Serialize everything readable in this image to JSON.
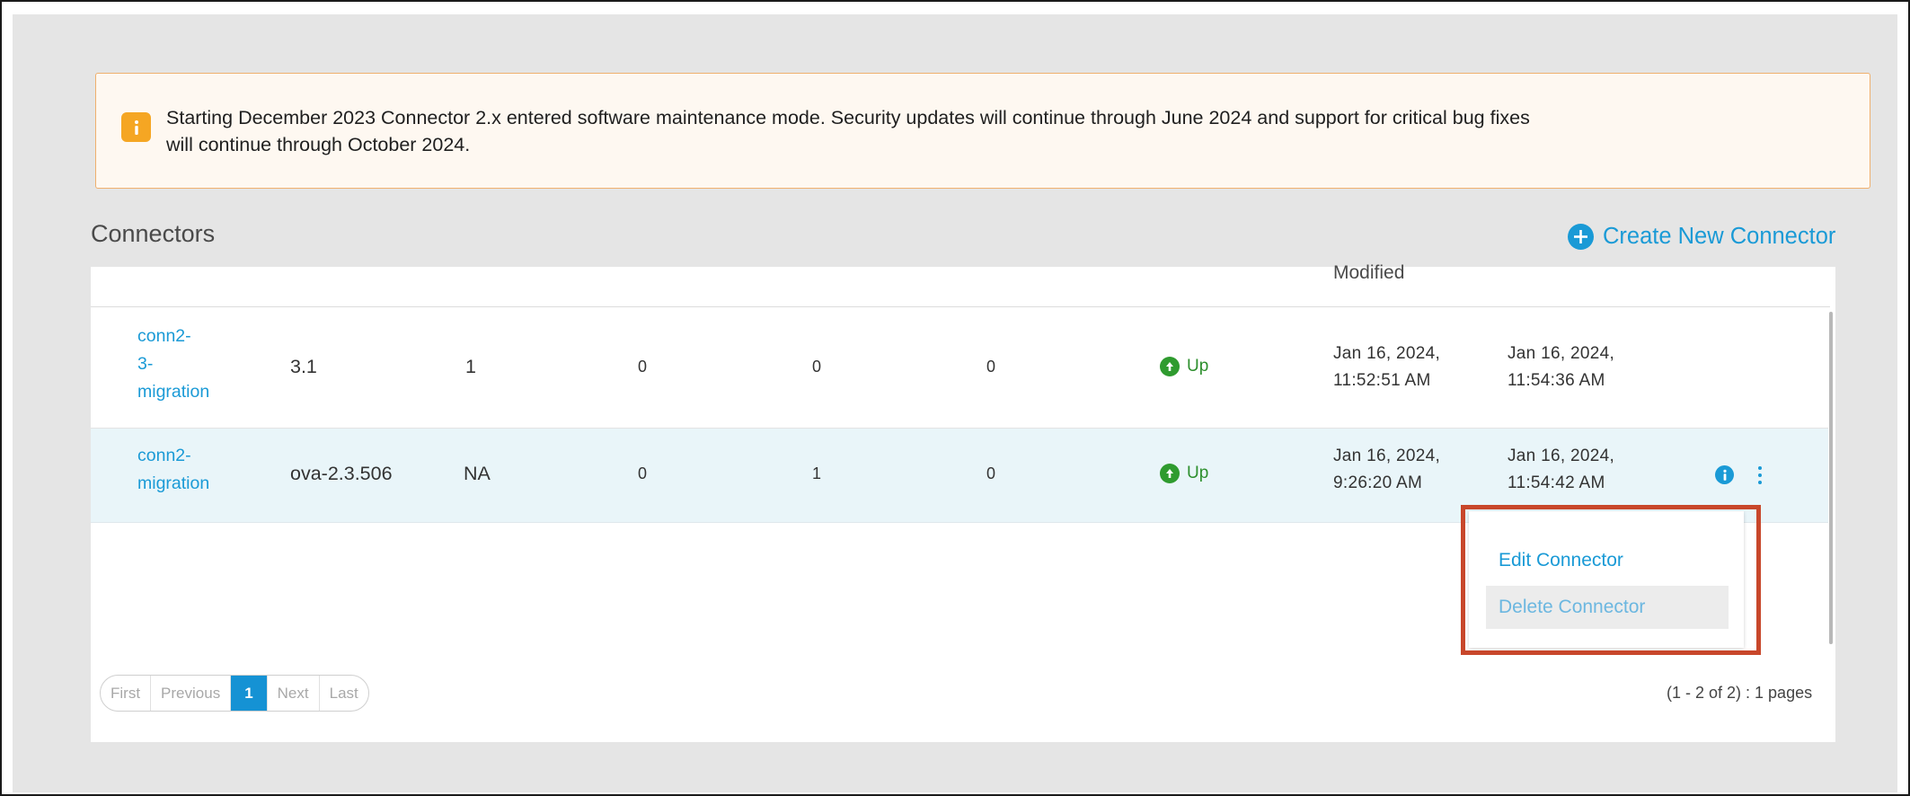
{
  "banner": {
    "icon": "info-icon",
    "text_line1": "Starting December 2023 Connector 2.x entered software maintenance mode. Security updates will continue through June 2024 and support for critical bug fixes",
    "text_line2": "will continue through October 2024.",
    "color": "#f5a623"
  },
  "header": {
    "title": "Connectors",
    "create_label": "Create New Connector",
    "create_icon": "plus-circle-icon"
  },
  "table": {
    "visible_header": "Modified",
    "rows": [
      {
        "name_lines": [
          "conn2-",
          "3-",
          "migration"
        ],
        "version": "3.1",
        "col3": "1",
        "col4": "0",
        "col5": "0",
        "col6": "0",
        "status": "Up",
        "modified_date": "Jan 16, 2024,",
        "modified_time": "11:52:51 AM",
        "last_date": "Jan 16, 2024,",
        "last_time": "11:54:36 AM"
      },
      {
        "name_lines": [
          "conn2-",
          "migration"
        ],
        "version": "ova-2.3.506",
        "col3": "NA",
        "col4": "0",
        "col5": "1",
        "col6": "0",
        "status": "Up",
        "modified_date": "Jan 16, 2024,",
        "modified_time": "9:26:20 AM",
        "last_date": "Jan 16, 2024,",
        "last_time": "11:54:42 AM"
      }
    ]
  },
  "menu": {
    "edit_label": "Edit Connector",
    "delete_label": "Delete Connector"
  },
  "pagination": {
    "first": "First",
    "previous": "Previous",
    "current": "1",
    "next": "Next",
    "last": "Last",
    "summary": "(1 - 2 of 2) : 1 pages"
  },
  "colors": {
    "accent": "#1a9ad6",
    "status_up": "#2f9b2f",
    "highlight_border": "#c8472b",
    "selected_row": "#e9f5f9"
  }
}
